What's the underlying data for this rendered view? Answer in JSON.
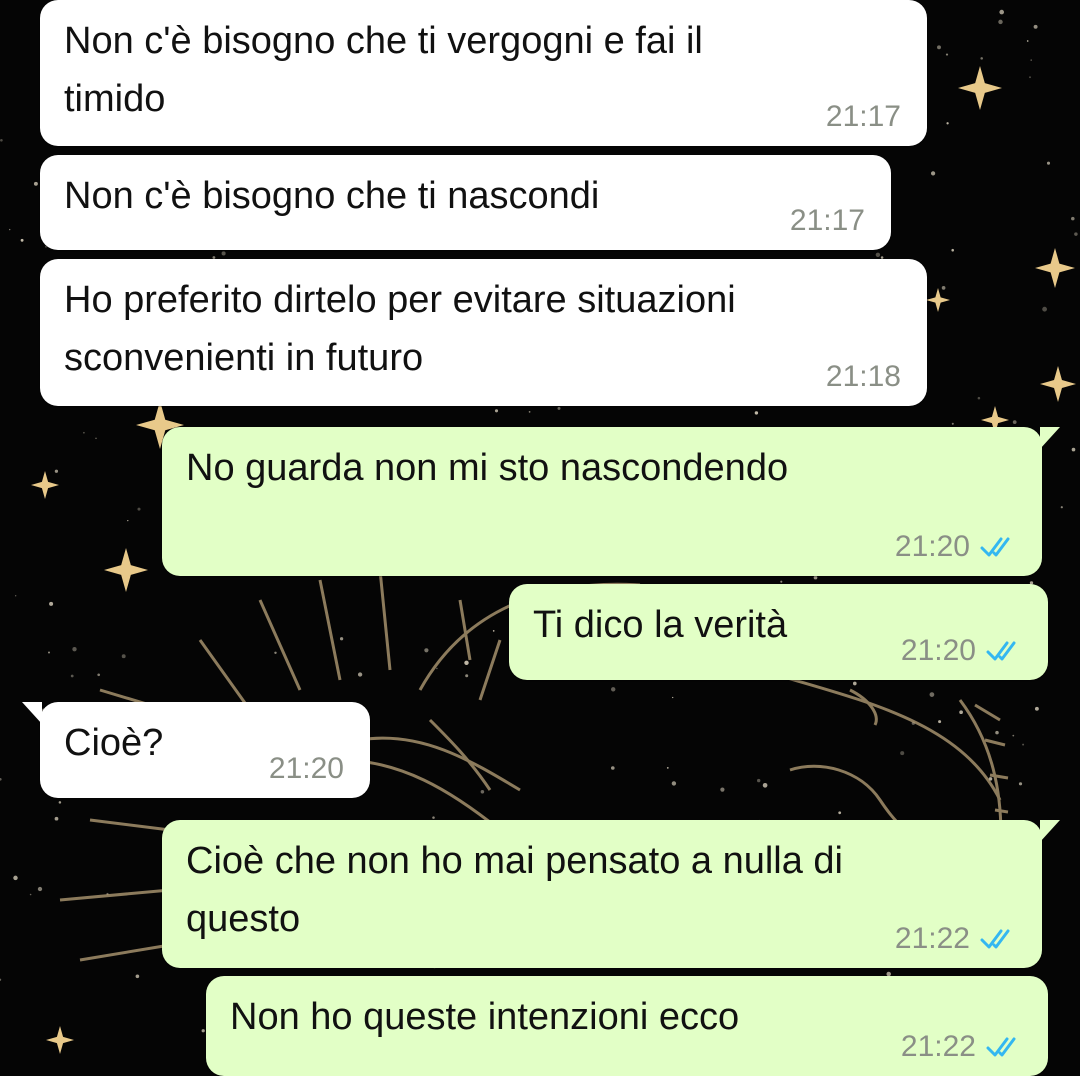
{
  "chat": {
    "messages": [
      {
        "direction": "in",
        "text": "Non c'è bisogno che ti vergogni e fai il\ntimido",
        "time": "21:17",
        "tail": false
      },
      {
        "direction": "in",
        "text": "Non c'è bisogno che ti nascondi",
        "time": "21:17",
        "tail": false
      },
      {
        "direction": "in",
        "text": "Ho preferito dirtelo per evitare situazioni\nsconvenienti in futuro",
        "time": "21:18",
        "tail": false
      },
      {
        "direction": "out",
        "text": "No guarda non mi sto nascondendo",
        "time": "21:20",
        "status": "read",
        "tail": true
      },
      {
        "direction": "out",
        "text": "Ti dico la verità",
        "time": "21:20",
        "status": "read",
        "tail": false
      },
      {
        "direction": "in",
        "text": "Cioè?",
        "time": "21:20",
        "tail": true
      },
      {
        "direction": "out",
        "text": "Cioè che non ho mai pensato a nulla di\nquesto",
        "time": "21:22",
        "status": "read",
        "tail": true
      },
      {
        "direction": "out",
        "text": "Non ho queste intenzioni ecco",
        "time": "21:22",
        "status": "read",
        "tail": false
      }
    ]
  },
  "colors": {
    "incoming_bubble": "#ffffff",
    "outgoing_bubble": "#e2ffc6",
    "read_ticks": "#34b7f1",
    "timestamp": "#8a8f86",
    "wallpaper": "#050505"
  },
  "icons": {
    "read_receipt": "double-check-icon"
  }
}
